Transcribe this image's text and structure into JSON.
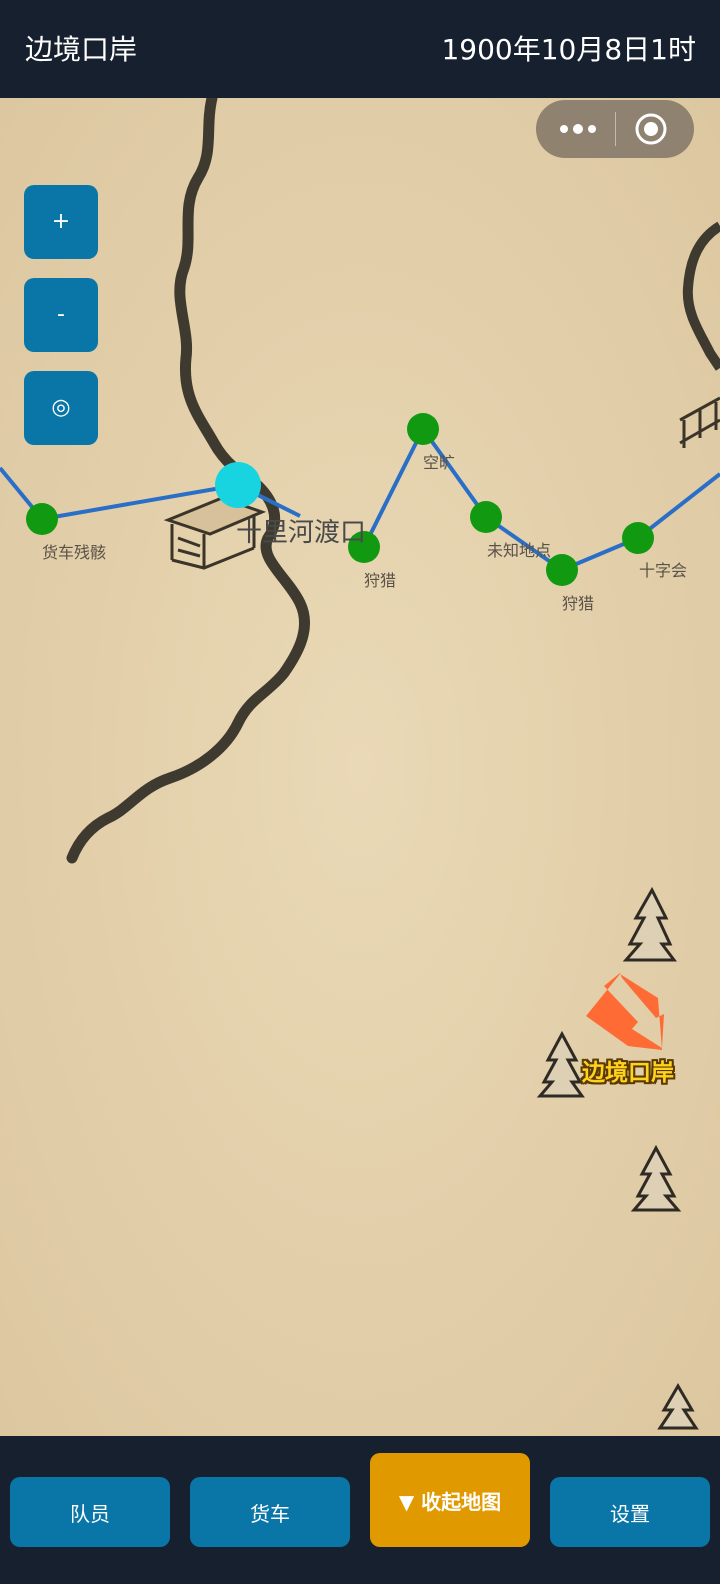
{
  "header": {
    "title": "边境口岸",
    "datetime": "1900年10月8日1时"
  },
  "map": {
    "controls": {
      "zoom_in": "+",
      "zoom_out": "-",
      "locate": "◎"
    },
    "nodes": [
      {
        "id": "wreck",
        "label": "货车残骸"
      },
      {
        "id": "hunt1",
        "label": "狩猎"
      },
      {
        "id": "empty",
        "label": "空旷"
      },
      {
        "id": "unknown",
        "label": "未知地点"
      },
      {
        "id": "hunt2",
        "label": "狩猎"
      },
      {
        "id": "cross",
        "label": "十字会"
      }
    ],
    "current_location": "十里河渡口",
    "destination": "边境口岸",
    "colors": {
      "route": "#2a6fc7",
      "node": "#119a11",
      "current": "#18d4e0",
      "arrow": "#ff6b35",
      "parchment": "#e6d5b2"
    }
  },
  "nav": {
    "crew": "队员",
    "truck": "货车",
    "collapse_map": "▼ 收起地图",
    "settings": "设置"
  }
}
